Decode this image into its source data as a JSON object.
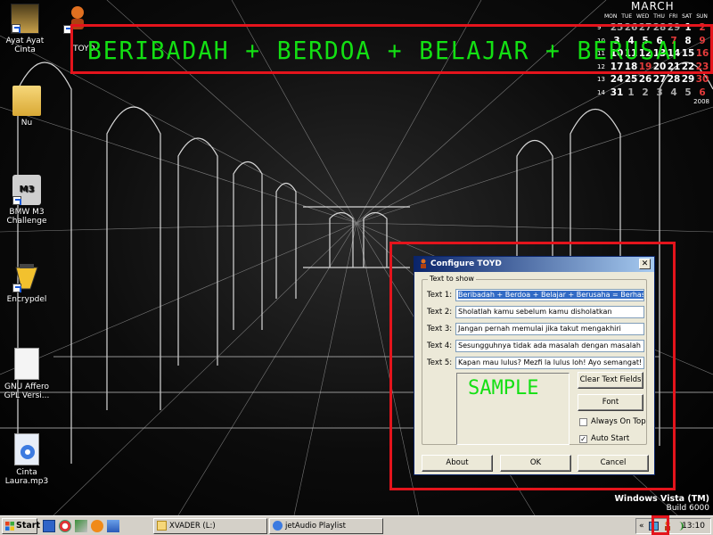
{
  "desktop": {
    "icons": [
      {
        "label": "Ayat Ayat Cinta"
      },
      {
        "label": "TOYD"
      },
      {
        "label": "Nu"
      },
      {
        "label": "BMW M3 Challenge"
      },
      {
        "label": "Encrypdel"
      },
      {
        "label": "GNU Affero GPL Versi..."
      },
      {
        "label": "Cinta Laura.mp3"
      }
    ],
    "bmw_badge": "M3"
  },
  "banner": {
    "text": "BERIBADAH + BERDOA + BELAJAR + BERUSAHA ="
  },
  "calendar": {
    "month": "MARCH",
    "day_headers": "MON TUE WED THU FRI SAT SUN",
    "weeks": [
      {
        "week": "9",
        "days": [
          "25",
          "26",
          "27",
          "28",
          "29",
          "1",
          "2"
        ]
      },
      {
        "week": "10",
        "days": [
          "3",
          "4",
          "5",
          "6",
          "7",
          "8",
          "9"
        ]
      },
      {
        "week": "11",
        "days": [
          "10",
          "11",
          "12",
          "13",
          "14",
          "15",
          "16"
        ]
      },
      {
        "week": "12",
        "days": [
          "17",
          "18",
          "19",
          "20",
          "21",
          "22",
          "23"
        ]
      },
      {
        "week": "13",
        "days": [
          "24",
          "25",
          "26",
          "27",
          "28",
          "29",
          "30"
        ]
      },
      {
        "week": "14",
        "days": [
          "31",
          "1",
          "2",
          "3",
          "4",
          "5",
          "6"
        ]
      }
    ],
    "year": "2008"
  },
  "dialog": {
    "title": "Configure TOYD",
    "close_glyph": "✕",
    "group_label": "Text to show",
    "fields": [
      {
        "label": "Text 1:",
        "value": "Beribadah + Berdoa + Belajar + Berusaha = Berhasil"
      },
      {
        "label": "Text 2:",
        "value": "Sholatlah kamu sebelum kamu disholatkan"
      },
      {
        "label": "Text 3:",
        "value": "Jangan pernah memulai jika takut mengakhiri"
      },
      {
        "label": "Text 4:",
        "value": "Sesungguhnya tidak ada masalah dengan masalah karena"
      },
      {
        "label": "Text 5:",
        "value": "Kapan mau lulus? Mezfi la lulus loh! Ayo semangat!"
      }
    ],
    "sample_text": "SAMPLE",
    "buttons": {
      "clear": "Clear Text Fields",
      "font": "Font",
      "about": "About",
      "ok": "OK",
      "cancel": "Cancel"
    },
    "always_on_top": {
      "label": "Always On Top",
      "checked": false
    },
    "auto_start": {
      "label": "Auto Start",
      "checked": true,
      "mark": "✓"
    }
  },
  "watermark": {
    "product": "Windows Vista (TM)",
    "build": "Build 6000"
  },
  "taskbar": {
    "start_label": "Start",
    "tasks": [
      {
        "label": "XVADER (L:)"
      },
      {
        "label": "jetAudio Playlist"
      }
    ],
    "tray_chevron": "«",
    "clock": "13:10"
  },
  "colors": {
    "banner_text": "#13e013",
    "highlight_box": "#e4141c",
    "dialog_title_start": "#0a246a",
    "taskbar_bg": "#d4d0c8"
  }
}
